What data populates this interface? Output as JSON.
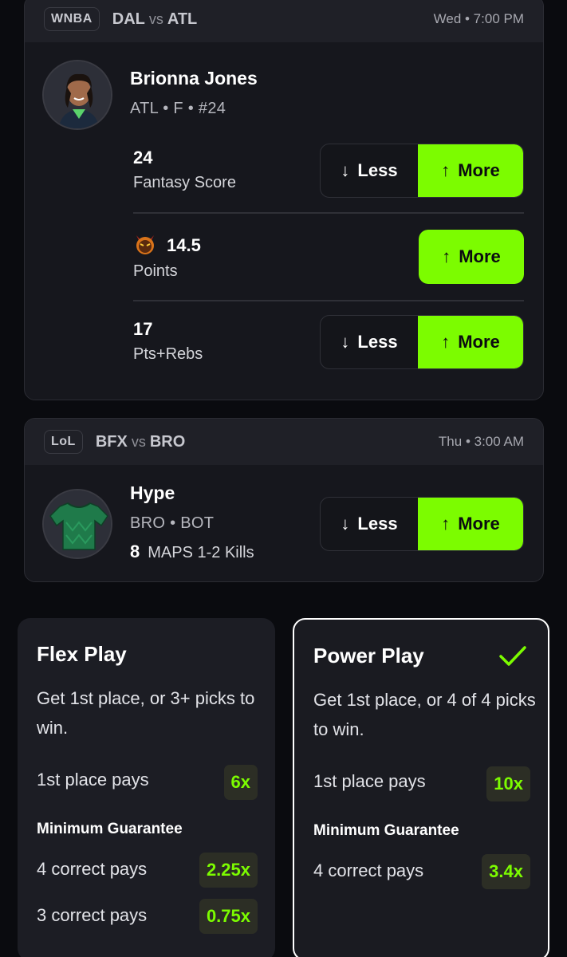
{
  "card1": {
    "league": "WNBA",
    "team_a": "DAL",
    "vs": "vs",
    "team_b": "ATL",
    "time": "Wed • 7:00 PM",
    "player_name": "Brionna Jones",
    "player_meta": "ATL • F • #24",
    "props": [
      {
        "value": "24",
        "label": "Fantasy Score",
        "less_label": "Less",
        "more_label": "More"
      },
      {
        "value": "14.5",
        "label": "Points",
        "more_label": "More",
        "icon": "devil-icon"
      },
      {
        "value": "17",
        "label": "Pts+Rebs",
        "less_label": "Less",
        "more_label": "More"
      }
    ]
  },
  "card2": {
    "league": "LoL",
    "team_a": "BFX",
    "vs": "vs",
    "team_b": "BRO",
    "time": "Thu • 3:00 AM",
    "player_name": "Hype",
    "player_meta": "BRO • BOT",
    "prop_value": "8",
    "prop_label": "MAPS 1-2 Kills",
    "less_label": "Less",
    "more_label": "More"
  },
  "flex": {
    "title": "Flex Play",
    "desc": "Get 1st place, or 3+ picks to win.",
    "first_label": "1st place pays",
    "first_mult": "6x",
    "min_guarantee": "Minimum Guarantee",
    "rows": [
      {
        "label": "4 correct pays",
        "mult": "2.25x"
      },
      {
        "label": "3 correct pays",
        "mult": "0.75x"
      }
    ]
  },
  "power": {
    "title": "Power Play",
    "desc": "Get 1st place, or 4 of 4 picks to win.",
    "first_label": "1st place pays",
    "first_mult": "10x",
    "min_guarantee": "Minimum Guarantee",
    "rows": [
      {
        "label": "4 correct pays",
        "mult": "3.4x"
      }
    ]
  },
  "arrows": {
    "down": "↓",
    "up": "↑"
  },
  "colors": {
    "accent": "#7cfc00",
    "card": "#16171d",
    "background": "#0a0b0f"
  }
}
